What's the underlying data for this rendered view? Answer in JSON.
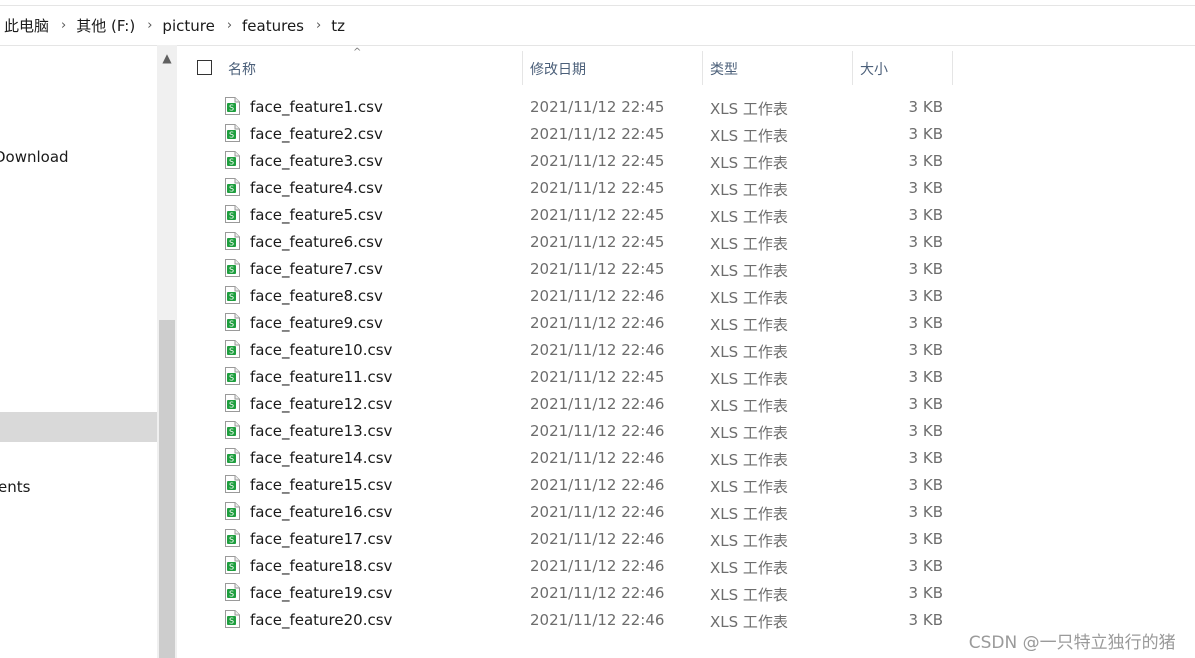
{
  "breadcrumb": [
    "此电脑",
    "其他 (F:)",
    "picture",
    "features",
    "tz"
  ],
  "nav": {
    "items": [
      {
        "label": "Download"
      },
      {
        "label": ""
      },
      {
        "label": "ents"
      }
    ]
  },
  "columns": {
    "name": "名称",
    "date": "修改日期",
    "type": "类型",
    "size": "大小"
  },
  "files": [
    {
      "name": "face_feature1.csv",
      "date": "2021/11/12 22:45",
      "type": "XLS 工作表",
      "size": "3 KB"
    },
    {
      "name": "face_feature2.csv",
      "date": "2021/11/12 22:45",
      "type": "XLS 工作表",
      "size": "3 KB"
    },
    {
      "name": "face_feature3.csv",
      "date": "2021/11/12 22:45",
      "type": "XLS 工作表",
      "size": "3 KB"
    },
    {
      "name": "face_feature4.csv",
      "date": "2021/11/12 22:45",
      "type": "XLS 工作表",
      "size": "3 KB"
    },
    {
      "name": "face_feature5.csv",
      "date": "2021/11/12 22:45",
      "type": "XLS 工作表",
      "size": "3 KB"
    },
    {
      "name": "face_feature6.csv",
      "date": "2021/11/12 22:45",
      "type": "XLS 工作表",
      "size": "3 KB"
    },
    {
      "name": "face_feature7.csv",
      "date": "2021/11/12 22:45",
      "type": "XLS 工作表",
      "size": "3 KB"
    },
    {
      "name": "face_feature8.csv",
      "date": "2021/11/12 22:46",
      "type": "XLS 工作表",
      "size": "3 KB"
    },
    {
      "name": "face_feature9.csv",
      "date": "2021/11/12 22:46",
      "type": "XLS 工作表",
      "size": "3 KB"
    },
    {
      "name": "face_feature10.csv",
      "date": "2021/11/12 22:46",
      "type": "XLS 工作表",
      "size": "3 KB"
    },
    {
      "name": "face_feature11.csv",
      "date": "2021/11/12 22:45",
      "type": "XLS 工作表",
      "size": "3 KB"
    },
    {
      "name": "face_feature12.csv",
      "date": "2021/11/12 22:46",
      "type": "XLS 工作表",
      "size": "3 KB"
    },
    {
      "name": "face_feature13.csv",
      "date": "2021/11/12 22:46",
      "type": "XLS 工作表",
      "size": "3 KB"
    },
    {
      "name": "face_feature14.csv",
      "date": "2021/11/12 22:46",
      "type": "XLS 工作表",
      "size": "3 KB"
    },
    {
      "name": "face_feature15.csv",
      "date": "2021/11/12 22:46",
      "type": "XLS 工作表",
      "size": "3 KB"
    },
    {
      "name": "face_feature16.csv",
      "date": "2021/11/12 22:46",
      "type": "XLS 工作表",
      "size": "3 KB"
    },
    {
      "name": "face_feature17.csv",
      "date": "2021/11/12 22:46",
      "type": "XLS 工作表",
      "size": "3 KB"
    },
    {
      "name": "face_feature18.csv",
      "date": "2021/11/12 22:46",
      "type": "XLS 工作表",
      "size": "3 KB"
    },
    {
      "name": "face_feature19.csv",
      "date": "2021/11/12 22:46",
      "type": "XLS 工作表",
      "size": "3 KB"
    },
    {
      "name": "face_feature20.csv",
      "date": "2021/11/12 22:46",
      "type": "XLS 工作表",
      "size": "3 KB"
    }
  ],
  "icons": {
    "file": "spreadsheet-file-icon",
    "separator": "chevron-right-icon",
    "sort": "sort-ascending-icon",
    "scroll_up": "scroll-up-arrow-icon"
  },
  "colors": {
    "header_text": "#4c607a",
    "file_icon_green": "#1e9e3e",
    "selection": "#d9d9d9"
  },
  "watermark": "CSDN @一只特立独行的猪  ️"
}
